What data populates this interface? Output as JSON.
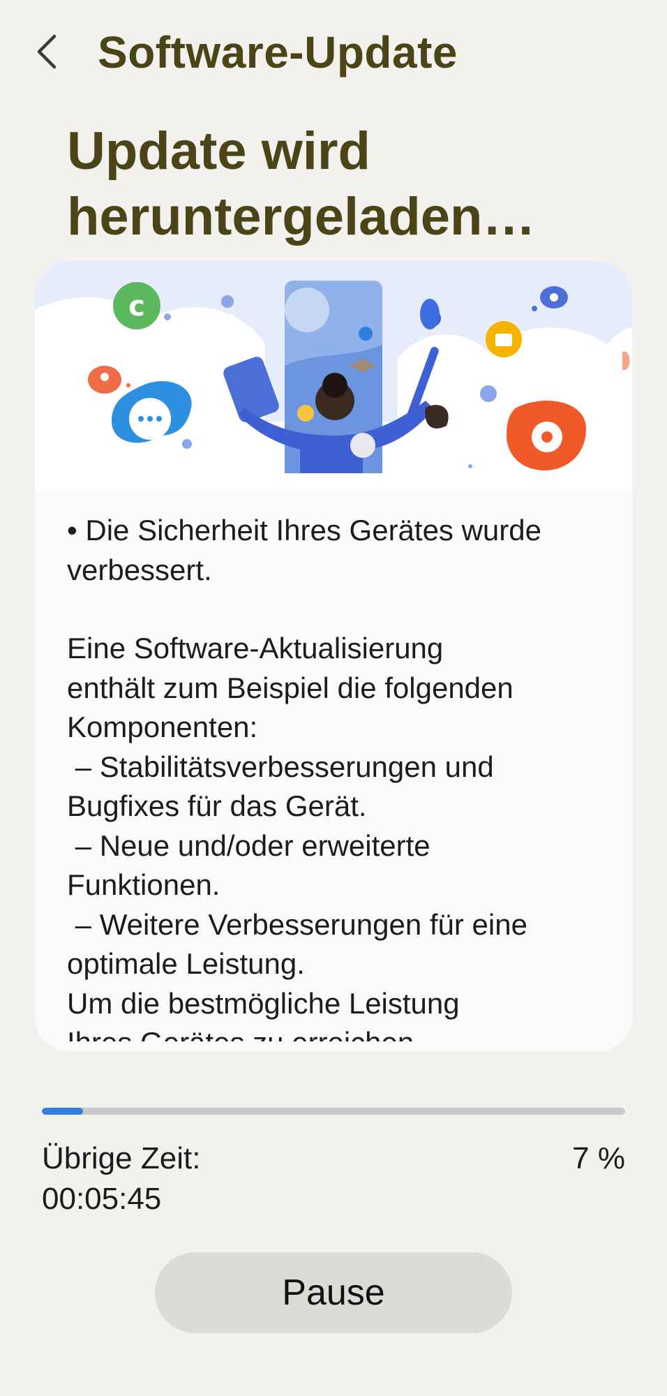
{
  "header": {
    "title": "Software-Update",
    "back_icon": "chevron-left-icon"
  },
  "status": {
    "title_line1": "Update wird",
    "title_line2": "heruntergeladen…"
  },
  "notes": {
    "paragraph1": "• Die Sicherheit Ihres Gerätes wurde\nverbessert.",
    "paragraph2": "Eine Software-Aktualisierung\nenthält zum Beispiel die folgenden\nKomponenten:\n – Stabilitätsverbesserungen und\nBugfixes für das Gerät.\n – Neue und/oder erweiterte\nFunktionen.\n – Weitere Verbesserungen für eine\noptimale Leistung.\nUm die bestmögliche Leistung\nIhres Gerätes zu erreichen"
  },
  "progress": {
    "percent_value": 7,
    "percent_label": "7 %",
    "remaining_label": "Übrige Zeit:",
    "remaining_time": "00:05:45",
    "fill_color": "#2f7fe1",
    "track_color": "#c8c8c8"
  },
  "actions": {
    "pause_label": "Pause"
  },
  "colors": {
    "title": "#4a4416",
    "background": "#f2f1ee",
    "card": "#fafafa"
  }
}
